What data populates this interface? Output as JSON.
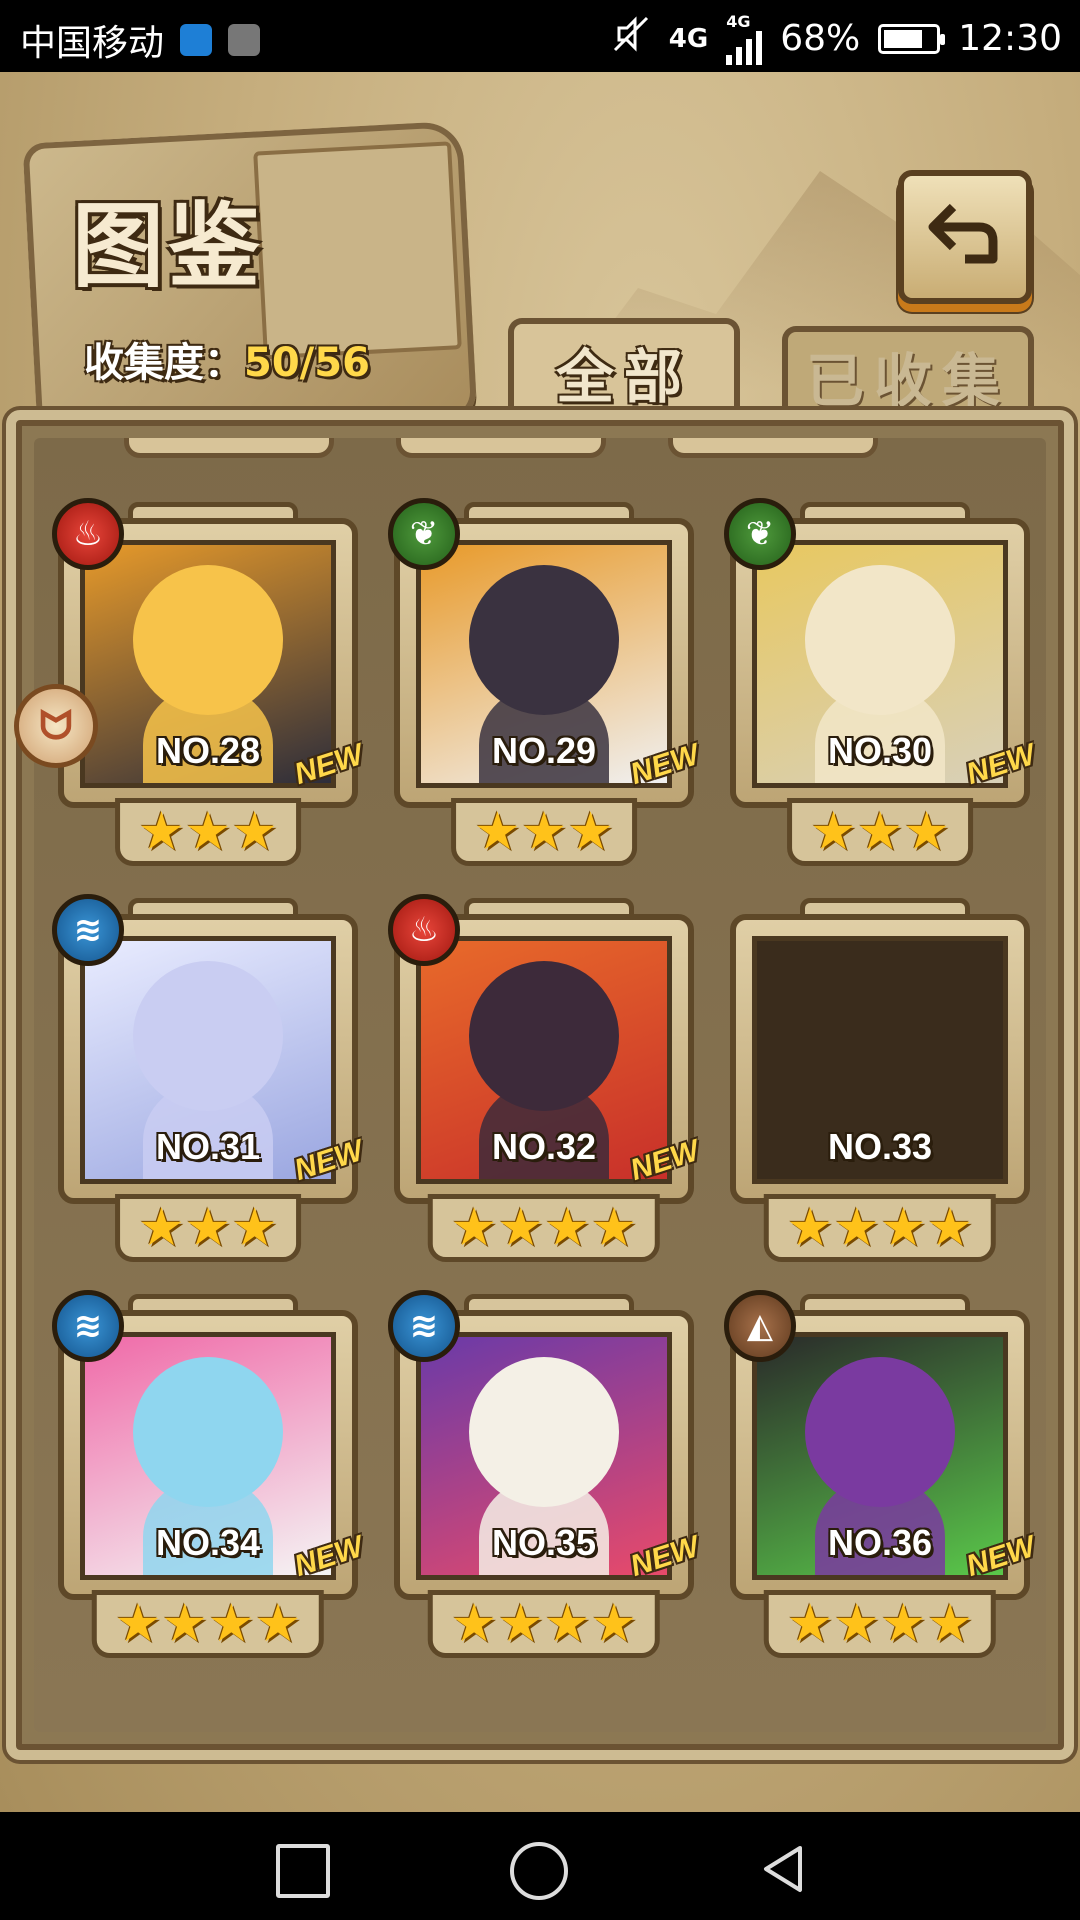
{
  "status_bar": {
    "carrier": "中国移动",
    "network": "4G",
    "network2": "4G",
    "battery": "68%",
    "battery_level": 0.68,
    "time": "12:30"
  },
  "header": {
    "title": "图鉴",
    "progress_label": "收集度：",
    "progress_value": "50/56"
  },
  "tabs": [
    {
      "label": "全部",
      "active": true
    },
    {
      "label": "已收集",
      "active": false
    }
  ],
  "cards": [
    {
      "no": "NO.28",
      "stars": "★★★",
      "new": "NEW",
      "element": "fire",
      "element_icon": "fire-icon",
      "palette": [
        "#f7c34a",
        "#e79a2a",
        "#2d2d3a"
      ],
      "collected": true
    },
    {
      "no": "NO.29",
      "stars": "★★★",
      "new": "NEW",
      "element": "leaf",
      "element_icon": "leaf-icon",
      "palette": [
        "#3a3240",
        "#e89a2a",
        "#f0f0f0"
      ],
      "collected": true
    },
    {
      "no": "NO.30",
      "stars": "★★★",
      "new": "NEW",
      "element": "leaf",
      "element_icon": "leaf-icon",
      "palette": [
        "#f2e6c8",
        "#e8c860",
        "#d8d0b8"
      ],
      "collected": true
    },
    {
      "no": "NO.31",
      "stars": "★★★",
      "new": "NEW",
      "element": "water",
      "element_icon": "water-icon",
      "palette": [
        "#c9cdf2",
        "#e9ecff",
        "#9aa6e0"
      ],
      "collected": true
    },
    {
      "no": "NO.32",
      "stars": "★★★★",
      "new": "NEW",
      "element": "fire",
      "element_icon": "fire-icon",
      "palette": [
        "#3d2a3a",
        "#e86a2a",
        "#c8302a"
      ],
      "collected": true
    },
    {
      "no": "NO.33",
      "stars": "★★★★",
      "new": "",
      "element": "",
      "element_icon": "",
      "palette": [
        "#3a2c1c",
        "#3a2c1c",
        "#3a2c1c"
      ],
      "collected": false
    },
    {
      "no": "NO.34",
      "stars": "★★★★",
      "new": "NEW",
      "element": "water",
      "element_icon": "water-icon",
      "palette": [
        "#8fd6ef",
        "#f06aa8",
        "#f4f4f4"
      ],
      "collected": true
    },
    {
      "no": "NO.35",
      "stars": "★★★★",
      "new": "NEW",
      "element": "water",
      "element_icon": "water-icon",
      "palette": [
        "#f4f0e6",
        "#6a3aa8",
        "#e84a6a"
      ],
      "collected": true
    },
    {
      "no": "NO.36",
      "stars": "★★★★",
      "new": "NEW",
      "element": "earth",
      "element_icon": "earth-icon",
      "palette": [
        "#7a3aa0",
        "#2a2a2a",
        "#5ac84a"
      ],
      "collected": true
    }
  ],
  "nav": {
    "recent_icon": "square-icon",
    "home_icon": "circle-icon",
    "back_icon": "triangle-back-icon"
  }
}
